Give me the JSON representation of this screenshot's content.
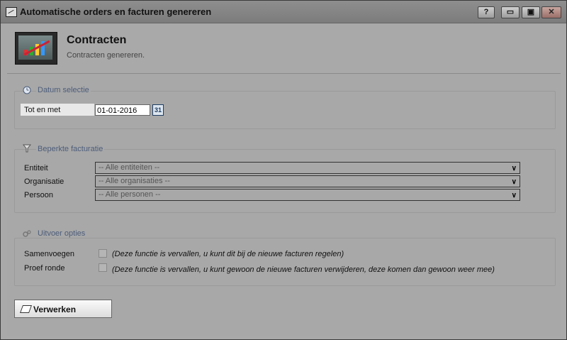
{
  "window": {
    "title": "Automatische orders en facturen genereren",
    "help_label": "?",
    "minimize_label": "▭",
    "maximize_label": "▣",
    "close_label": "✕"
  },
  "header": {
    "title": "Contracten",
    "subtitle": "Contracten genereren."
  },
  "datum": {
    "group_title": "Datum selectie",
    "tot_en_met_label": "Tot en met",
    "tot_en_met_value": "01-01-2016",
    "calendar_label": "31"
  },
  "facturatie": {
    "group_title": "Beperkte facturatie",
    "entiteit_label": "Entiteit",
    "entiteit_value": "-- Alle entiteiten --",
    "organisatie_label": "Organisatie",
    "organisatie_value": "-- Alle organisaties --",
    "persoon_label": "Persoon",
    "persoon_value": "-- Alle personen --"
  },
  "uitvoer": {
    "group_title": "Uitvoer opties",
    "samenvoegen_label": "Samenvoegen",
    "samenvoegen_note": "(Deze functie is vervallen, u kunt dit bij de nieuwe facturen regelen)",
    "proef_label": "Proef ronde",
    "proef_note": "(Deze functie is vervallen, u kunt gewoon de nieuwe facturen verwijderen, deze komen dan gewoon weer mee)"
  },
  "actions": {
    "verwerken_label": "Verwerken"
  },
  "colors": {
    "group_title": "#4c5d7a",
    "background": "#a8a8a8"
  }
}
